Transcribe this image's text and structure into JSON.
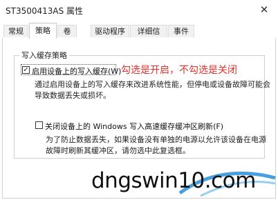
{
  "window": {
    "title": "ST3500413AS 属性",
    "close_glyph": "✕"
  },
  "tabs": [
    {
      "label": "常规"
    },
    {
      "label": "策略"
    },
    {
      "label": "卷"
    },
    {
      "label": "驱动程序"
    },
    {
      "label": "详细信息"
    },
    {
      "label": "事件"
    }
  ],
  "group": {
    "title": "写入缓存策略",
    "option1": {
      "label": "启用设备上的写入缓存(W)",
      "checked": true,
      "description": [
        "通过启用设备上的写入缓存来改进系统性能，但停电或设备故障可能会",
        "导致数据丢失或损坏。"
      ]
    },
    "annotation": "勾选是开启，不勾选是关闭",
    "option2": {
      "label": "关闭设备上的 Windows 写入高速缓存缓冲区刷新(F)",
      "checked": false,
      "description": [
        "为了防止数据丢失，如果设备没有单独的电源以允许该设备在电源",
        "故障时刷新其缓冲区，请勿选中此复选框。"
      ]
    }
  },
  "watermark": {
    "text": "dngswin10.com"
  },
  "colors": {
    "annotation": "#e0302a",
    "accent": "#2a8fd8"
  }
}
